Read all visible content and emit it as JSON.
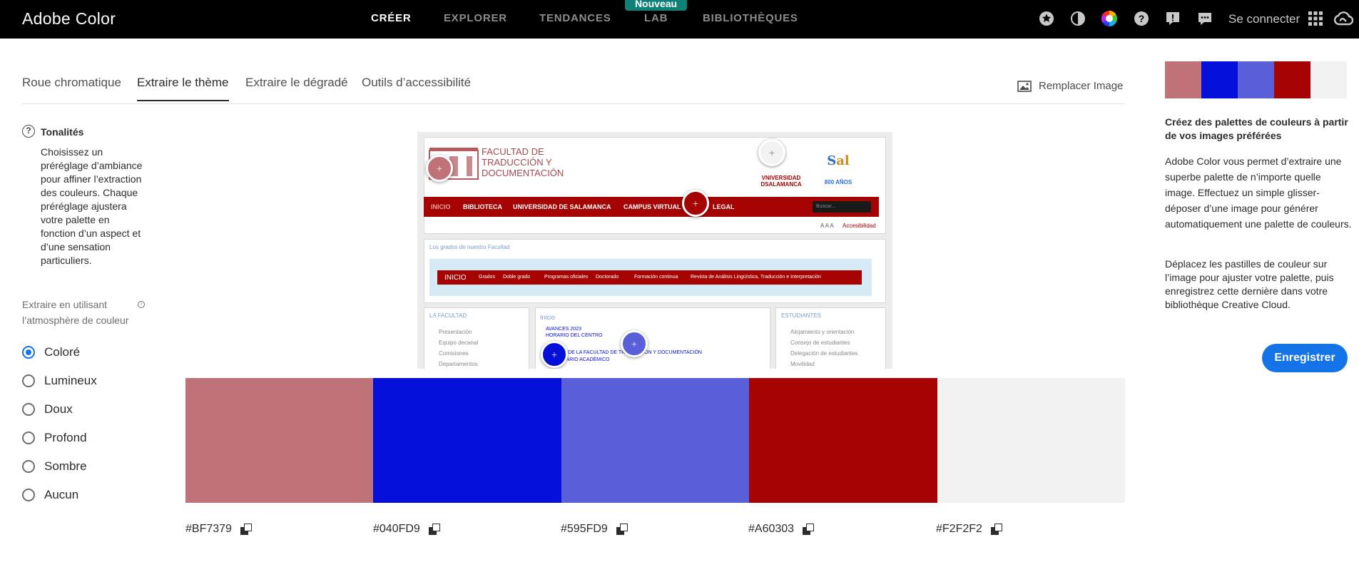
{
  "app": {
    "title": "Adobe Color"
  },
  "nav": {
    "items": [
      {
        "label": "CRÉER",
        "active": true
      },
      {
        "label": "EXPLORER"
      },
      {
        "label": "TENDANCES"
      },
      {
        "label": "LAB"
      },
      {
        "label": "BIBLIOTHÈQUES"
      }
    ],
    "badge": "Nouveau"
  },
  "header": {
    "icons": [
      "star-icon",
      "contrast-icon",
      "color-wheel-icon",
      "help-icon",
      "feedback-icon",
      "chat-icon",
      "apps-grid-icon",
      "creative-cloud-icon"
    ],
    "signin": "Se connecter"
  },
  "tabs": [
    {
      "label": "Roue chromatique"
    },
    {
      "label": "Extraire le thème",
      "active": true
    },
    {
      "label": "Extraire le dégradé"
    },
    {
      "label": "Outils d’accessibilité"
    }
  ],
  "replace_image": "Remplacer Image",
  "left_panel": {
    "title": "Tonalités",
    "description": "Choisissez un préréglage d’ambiance pour affiner l’extraction des couleurs. Chaque préréglage ajustera votre palette en fonction d’un aspect et d’une sensation particuliers.",
    "extract_label": "Extraire en utilisant l’atmosphère de couleur",
    "moods": [
      {
        "label": "Coloré",
        "checked": true
      },
      {
        "label": "Lumineux"
      },
      {
        "label": "Doux"
      },
      {
        "label": "Profond"
      },
      {
        "label": "Sombre"
      },
      {
        "label": "Aucun"
      }
    ]
  },
  "preview": {
    "header_title": "FACULTAD DE TRADUCCIÓN Y DOCUMENTACIÓN",
    "university": "VNIVERSIDAD DSALAMANCA",
    "anniversary": "800 AÑOS",
    "menu": [
      "INICIO",
      "BIBLIOTECA",
      "UNIVERSIDAD DE SALAMANCA",
      "CAMPUS VIRTUAL",
      "LEGAL"
    ],
    "search_placeholder": "Buscar...",
    "font_size_controls": "A A A",
    "accessibility": "Accesibilidad",
    "section_title": "Los grados de nuestro Facultad",
    "inner_menu": [
      "INICIO",
      "Grados",
      "Doble grado",
      "Programas oficiales",
      "Doctorado",
      "Formación continua",
      "Revista de Análisis Lingüística, Traducción e Interpretación"
    ],
    "left_box": {
      "title": "LA FACULTAD",
      "items": [
        "Presentación",
        "Equipo decanal",
        "Comisiones",
        "Departamentos"
      ]
    },
    "center_box": {
      "title": "Inicio",
      "items": [
        "AVANCES 2023",
        "HORARIO DEL CENTRO",
        "AGENDA DE LA FACULTAD DE TRADUCCIÓN Y DOCUMENTACIÓN",
        "CALENDARIO ACADÉMICO"
      ]
    },
    "right_box": {
      "title": "ESTUDIANTES",
      "items": [
        "Alojamiento y orientación",
        "Consejo de estudiantes",
        "Delegación de estudiantes",
        "Movilidad"
      ]
    }
  },
  "palette": [
    {
      "hex": "#BF7379",
      "color": "#BF7379"
    },
    {
      "hex": "#040FD9",
      "color": "#040FD9"
    },
    {
      "hex": "#595FD9",
      "color": "#595FD9"
    },
    {
      "hex": "#A60303",
      "color": "#A60303"
    },
    {
      "hex": "#F2F2F2",
      "color": "#F2F2F2"
    }
  ],
  "right_panel": {
    "title": "Créez des palettes de couleurs à partir de vos images préférées",
    "p1": "Adobe Color vous permet d’extraire une superbe palette de n’importe quelle image. Effectuez un simple glisser-déposer d’une image pour générer automatiquement une palette de couleurs.",
    "p2": "Déplacez les pastilles de couleur sur l’image pour ajuster votre palette, puis enregistrez cette dernière dans votre bibliothèque Creative Cloud.",
    "save_label": "Enregistrer"
  }
}
